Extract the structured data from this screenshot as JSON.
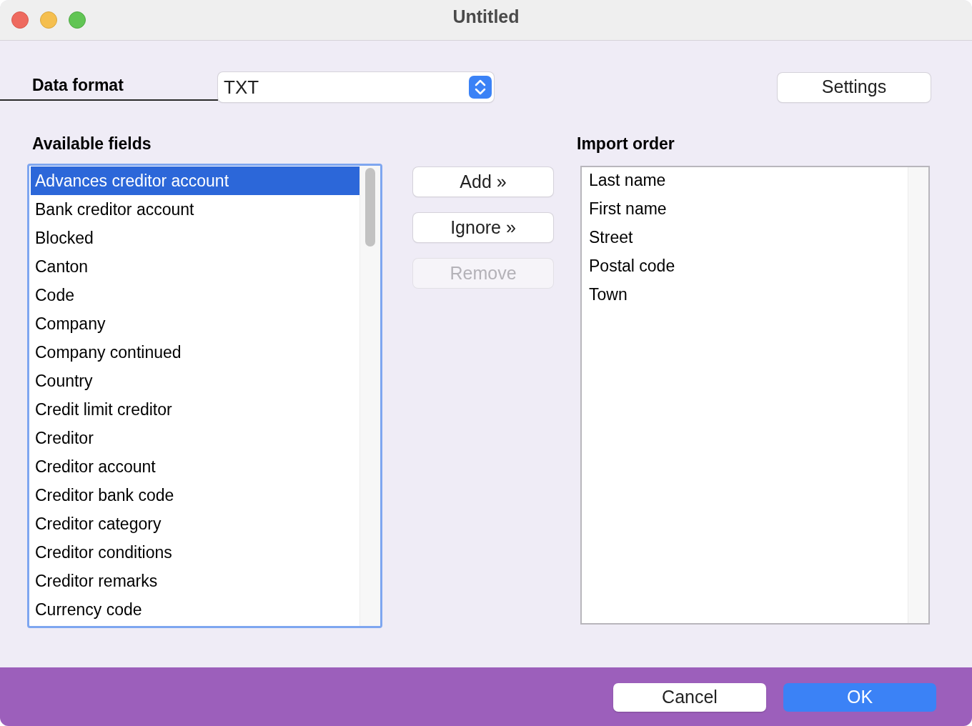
{
  "window": {
    "title": "Untitled"
  },
  "data_format": {
    "label": "Data format",
    "value": "TXT"
  },
  "settings_button": "Settings",
  "available_fields": {
    "title": "Available fields",
    "focused": true,
    "items": [
      {
        "label": "Advances creditor account",
        "selected": true
      },
      {
        "label": "Bank creditor account",
        "selected": false
      },
      {
        "label": "Blocked",
        "selected": false
      },
      {
        "label": "Canton",
        "selected": false
      },
      {
        "label": "Code",
        "selected": false
      },
      {
        "label": "Company",
        "selected": false
      },
      {
        "label": "Company continued",
        "selected": false
      },
      {
        "label": "Country",
        "selected": false
      },
      {
        "label": "Credit limit creditor",
        "selected": false
      },
      {
        "label": "Creditor",
        "selected": false
      },
      {
        "label": "Creditor account",
        "selected": false
      },
      {
        "label": "Creditor bank code",
        "selected": false
      },
      {
        "label": "Creditor category",
        "selected": false
      },
      {
        "label": "Creditor conditions",
        "selected": false
      },
      {
        "label": "Creditor remarks",
        "selected": false
      },
      {
        "label": "Currency code",
        "selected": false
      }
    ]
  },
  "actions": [
    {
      "label": "Add »",
      "disabled": false
    },
    {
      "label": "Ignore »",
      "disabled": false
    },
    {
      "label": "Remove",
      "disabled": true
    }
  ],
  "import_order": {
    "title": "Import order",
    "focused": false,
    "items": [
      {
        "label": "Last name",
        "selected": false
      },
      {
        "label": "First name",
        "selected": false
      },
      {
        "label": "Street",
        "selected": false
      },
      {
        "label": "Postal code",
        "selected": false
      },
      {
        "label": "Town",
        "selected": false
      }
    ]
  },
  "footer_buttons": [
    {
      "label": "Cancel",
      "default": false
    },
    {
      "label": "OK",
      "default": true
    }
  ]
}
